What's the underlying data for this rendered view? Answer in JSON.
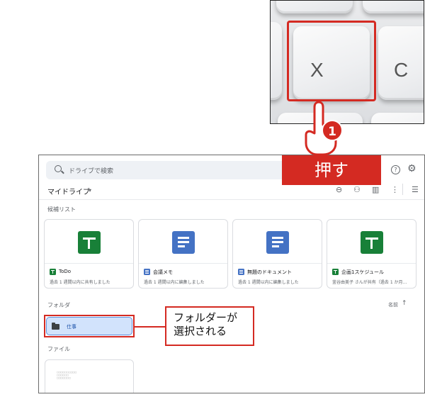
{
  "keyboard_photo": {
    "x_key": "X",
    "c_key": "C"
  },
  "annotations": {
    "step_number": "1",
    "action": "押す",
    "callout_line1": "フォルダーが",
    "callout_line2": "選択される",
    "accent_color": "#d42a22"
  },
  "drive": {
    "search_placeholder": "ドライブで検索",
    "help_icon": "?",
    "settings_icon": "⚙",
    "my_drive_label": "マイドライブ",
    "toolbar_icons": [
      "link-icon",
      "add-person-icon",
      "trash-icon",
      "more-icon",
      "list-view-icon"
    ],
    "suggested_label": "候補リスト",
    "suggested": [
      {
        "icon": "sheets",
        "title": "ToDo",
        "subtitle": "過去 1 週間以内に共有しました"
      },
      {
        "icon": "docs",
        "title": "会議メモ",
        "subtitle": "過去 1 週間以内に編集しました"
      },
      {
        "icon": "docs",
        "title": "無題のドキュメント",
        "subtitle": "過去 1 週間以内に編集しました"
      },
      {
        "icon": "sheets",
        "title": "企画1スケジュール",
        "subtitle": "釜谷由美子 さんが共有（過去 1 か月..."
      }
    ],
    "folders_label": "フォルダ",
    "sort_label": "名前",
    "sort_arrow": "↑",
    "folder_name": "仕事",
    "files_label": "ファイル",
    "file_preview": "□□□□□□□□□□\n□□□□□□\n□□□□□□□"
  }
}
